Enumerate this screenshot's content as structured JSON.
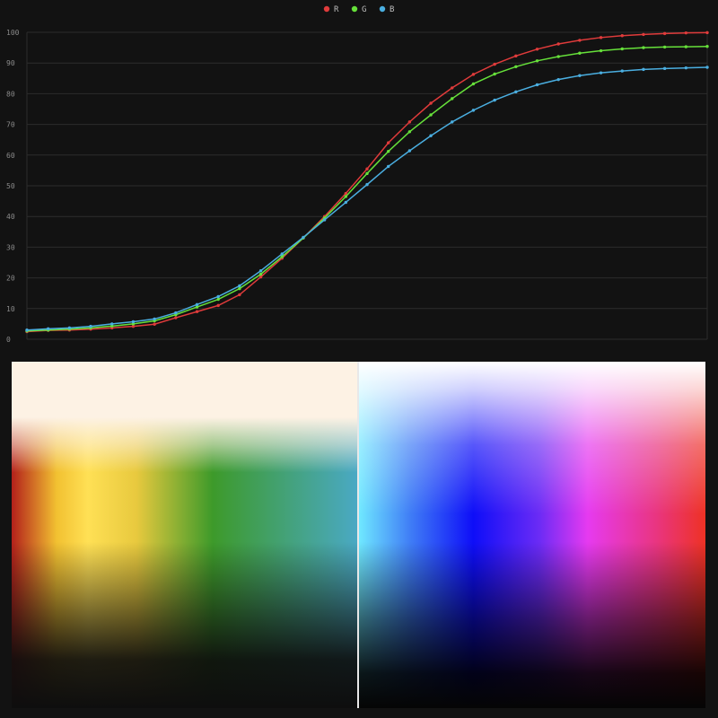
{
  "chart_data": {
    "type": "line",
    "title": "",
    "xlabel": "",
    "ylabel": "",
    "ylim": [
      0,
      100
    ],
    "yticks": [
      0,
      10,
      20,
      30,
      40,
      50,
      60,
      70,
      80,
      90,
      100
    ],
    "grid": true,
    "legend_placement": "top-center",
    "background": "#121212",
    "grid_color": "#2c2c2c",
    "tick_color": "#8a8a8a",
    "x": [
      0,
      1,
      2,
      3,
      4,
      5,
      6,
      7,
      8,
      9,
      10,
      11,
      12,
      13,
      14,
      15,
      16,
      17,
      18,
      19,
      20,
      21,
      22,
      23,
      24,
      25,
      26,
      27,
      28,
      29,
      30,
      31,
      32
    ],
    "series": [
      {
        "name": "R",
        "color": "#e03b3b",
        "values": [
          2.5,
          2.9,
          3.0,
          3.3,
          3.7,
          4.2,
          4.9,
          7.0,
          9.0,
          11.0,
          14.5,
          20.3,
          26.4,
          33.0,
          40.0,
          47.5,
          55.5,
          64.0,
          70.8,
          76.9,
          81.9,
          86.3,
          89.6,
          92.3,
          94.5,
          96.2,
          97.4,
          98.3,
          98.9,
          99.3,
          99.6,
          99.8,
          99.9
        ]
      },
      {
        "name": "G",
        "color": "#66e03a",
        "values": [
          2.7,
          3.0,
          3.3,
          3.7,
          4.3,
          5.0,
          6.0,
          8.0,
          10.5,
          13.0,
          16.5,
          21.2,
          26.9,
          33.0,
          39.5,
          46.5,
          54.0,
          61.2,
          67.6,
          73.1,
          78.4,
          83.2,
          86.4,
          88.8,
          90.7,
          92.1,
          93.2,
          94.0,
          94.6,
          95.0,
          95.2,
          95.3,
          95.4
        ]
      },
      {
        "name": "B",
        "color": "#4aaee0",
        "values": [
          3.0,
          3.4,
          3.7,
          4.2,
          5.0,
          5.7,
          6.6,
          8.6,
          11.3,
          13.9,
          17.4,
          22.3,
          27.8,
          33.2,
          38.9,
          44.6,
          50.4,
          56.3,
          61.4,
          66.3,
          70.8,
          74.6,
          77.9,
          80.6,
          82.9,
          84.6,
          85.9,
          86.8,
          87.4,
          87.9,
          88.2,
          88.4,
          88.6
        ]
      }
    ]
  },
  "legend": {
    "items": [
      {
        "label": "R",
        "color": "#e03b3b"
      },
      {
        "label": "G",
        "color": "#66e03a"
      },
      {
        "label": "B",
        "color": "#4aaee0"
      }
    ]
  },
  "panels": {
    "left": {
      "name": "gradient-map-left",
      "top_color": "#fdf2e4"
    },
    "right": {
      "name": "gradient-map-right",
      "top_color": "#ffffff"
    },
    "divider_color": "#e8e8e8"
  }
}
